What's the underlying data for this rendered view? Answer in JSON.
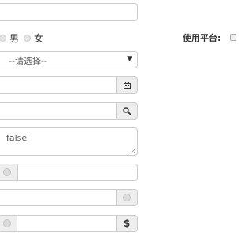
{
  "form": {
    "text_input_value": "",
    "gender": {
      "male_label": "男",
      "female_label": "女"
    },
    "platform_label": "使用平台:",
    "select_value": "--请选择--",
    "date_input_value": "",
    "search_input_value": "",
    "textarea_value": "false",
    "radio_addon_input_value": "",
    "radio_addon_right_input_value": "",
    "currency_input_value": "",
    "currency_symbol": "$"
  },
  "icons": {
    "calendar": "calendar-icon",
    "search": "search-icon",
    "select_caret": "caret-down-icon"
  }
}
